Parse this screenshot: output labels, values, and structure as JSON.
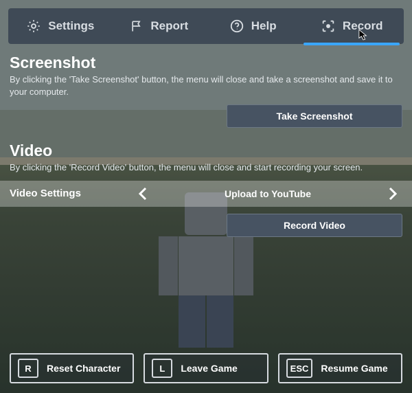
{
  "tabs": {
    "settings": "Settings",
    "report": "Report",
    "help": "Help",
    "record": "Record"
  },
  "screenshot": {
    "title": "Screenshot",
    "desc": "By clicking the 'Take Screenshot' button, the menu will close and take a screenshot and save it to your computer.",
    "button": "Take Screenshot"
  },
  "video": {
    "title": "Video",
    "desc": "By clicking the 'Record Video' button, the menu will close and start recording your screen.",
    "settings_label": "Video Settings",
    "settings_value": "Upload to YouTube",
    "button": "Record Video"
  },
  "footer": {
    "reset": {
      "key": "R",
      "label": "Reset Character"
    },
    "leave": {
      "key": "L",
      "label": "Leave Game"
    },
    "resume": {
      "key": "ESC",
      "label": "Resume Game"
    }
  }
}
